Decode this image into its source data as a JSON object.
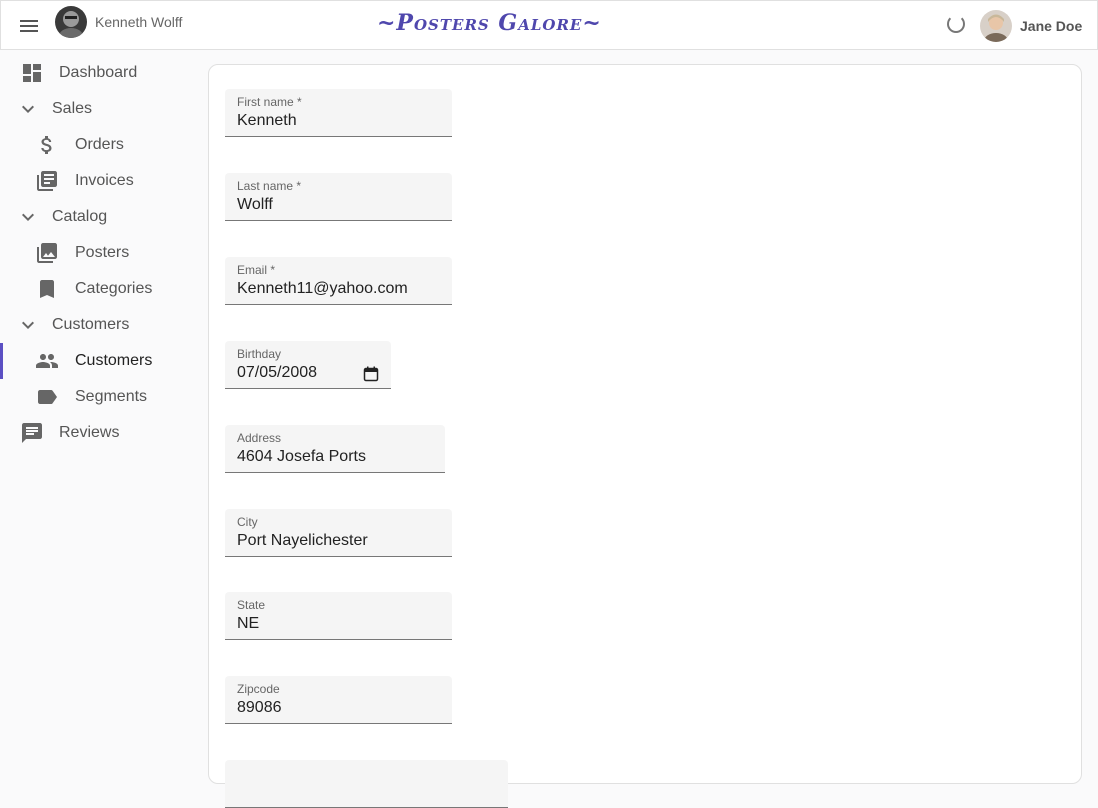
{
  "appbar": {
    "record_name": "Kenneth Wolff",
    "title": "~Posters Galore~",
    "user_name": "Jane Doe"
  },
  "sidebar": {
    "items": [
      {
        "label": "Dashboard"
      },
      {
        "label": "Sales"
      },
      {
        "label": "Orders"
      },
      {
        "label": "Invoices"
      },
      {
        "label": "Catalog"
      },
      {
        "label": "Posters"
      },
      {
        "label": "Categories"
      },
      {
        "label": "Customers"
      },
      {
        "label": "Customers"
      },
      {
        "label": "Segments"
      },
      {
        "label": "Reviews"
      }
    ]
  },
  "form": {
    "first_name": {
      "label": "First name *",
      "value": "Kenneth"
    },
    "last_name": {
      "label": "Last name *",
      "value": "Wolff"
    },
    "email": {
      "label": "Email *",
      "value": "Kenneth11@yahoo.com"
    },
    "birthday": {
      "label": "Birthday",
      "value": "07/05/2008"
    },
    "address": {
      "label": "Address",
      "value": "4604 Josefa Ports"
    },
    "city": {
      "label": "City",
      "value": "Port Nayelichester"
    },
    "state": {
      "label": "State",
      "value": "NE"
    },
    "zipcode": {
      "label": "Zipcode",
      "value": "89086"
    }
  },
  "colors": {
    "accent": "#5b4fc3",
    "title": "#4f47ad"
  }
}
